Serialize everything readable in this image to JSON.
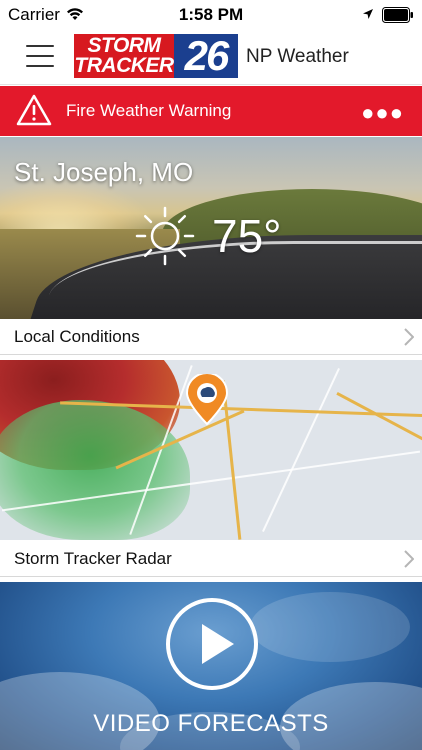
{
  "status_bar": {
    "carrier": "Carrier",
    "time": "1:58 PM"
  },
  "header": {
    "menu_icon": "hamburger-menu-icon",
    "logo_line1": "STORM",
    "logo_line2": "TRACKER",
    "logo_number": "26",
    "title": "NP Weather"
  },
  "alert": {
    "icon": "warning-triangle-icon",
    "text": "Fire Weather Warning",
    "more_icon": "ellipsis-icon",
    "more_label": "●●●",
    "color": "#e3192b"
  },
  "conditions": {
    "city": "St. Joseph, MO",
    "icon": "sunny-icon",
    "temperature": "75°",
    "label": "Local Conditions"
  },
  "radar": {
    "label": "Storm Tracker Radar"
  },
  "video": {
    "icon": "play-icon",
    "label": "VIDEO FORECASTS"
  },
  "colors": {
    "brand_red": "#d71920",
    "brand_blue": "#1b3f8f"
  }
}
